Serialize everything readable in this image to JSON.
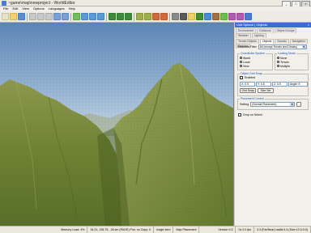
{
  "window": {
    "title": "~game\\map\\newproject - WorldEditor"
  },
  "menu": [
    "File",
    "Edit",
    "View",
    "Options",
    "Languages",
    "Help"
  ],
  "toolbar_icons": [
    "new-icon",
    "open-icon",
    "save-icon",
    "cut-icon",
    "copy-icon",
    "paste-icon",
    "undo-icon",
    "redo-icon",
    "select-icon",
    "move-icon",
    "rotate-icon",
    "scale-icon",
    "play-icon",
    "play-icon",
    "play-icon",
    "terrain-icon",
    "terrain-icon",
    "object-icon",
    "object-icon",
    "settings-icon",
    "camera-icon",
    "light-icon",
    "tree-icon",
    "water-icon",
    "road-icon",
    "grass-icon",
    "brush-icon",
    "brush-icon",
    "help-icon"
  ],
  "panel": {
    "title": "Unit Sphere | Objects",
    "close": "×",
    "tabs_row1": [
      "Environment",
      "Collisions",
      "Object Groups",
      "Weather",
      "Lighting"
    ],
    "tabs_row2": [
      "Terrain Objects",
      "Objects",
      "Sounds",
      "Navigation",
      "Regions"
    ],
    "selection_filter_label": "Selection Filter",
    "selection_filter_value": "All (except Terrain and Decals)",
    "coord_group": "Coordinate System",
    "coord_options": [
      "World",
      "Local",
      "View"
    ],
    "coord_selected": 0,
    "locking_group": "Locking Mode",
    "locking_options": [
      "None",
      "Terrain",
      "Multiple"
    ],
    "locking_selected": 2,
    "snap_group": "Object Grid Snap",
    "snap_enabled_label": "Enabled",
    "snap_fields": [
      "X: 0.5",
      "Y: 0.5",
      "Z: 0.5",
      "Angle: 5"
    ],
    "btn_gridsnap": "Grid Snap",
    "btn_size": "Size Set",
    "placement_group": "Placement Control",
    "setting_label": "Setting",
    "setting_value": "(Normal Placement)",
    "drop_label": "Drop on Select"
  },
  "status": [
    "",
    "Memory Load: 4%",
    "34.31, 135.75, -26 km (PAGE) Pos: no Copy: 0",
    "single Item",
    "Map Placement",
    "",
    "Version 9.3",
    "0x 2.0 fps",
    "3.3 (Far/Near) radial 4.4 (Size:12.0-0.0)"
  ]
}
